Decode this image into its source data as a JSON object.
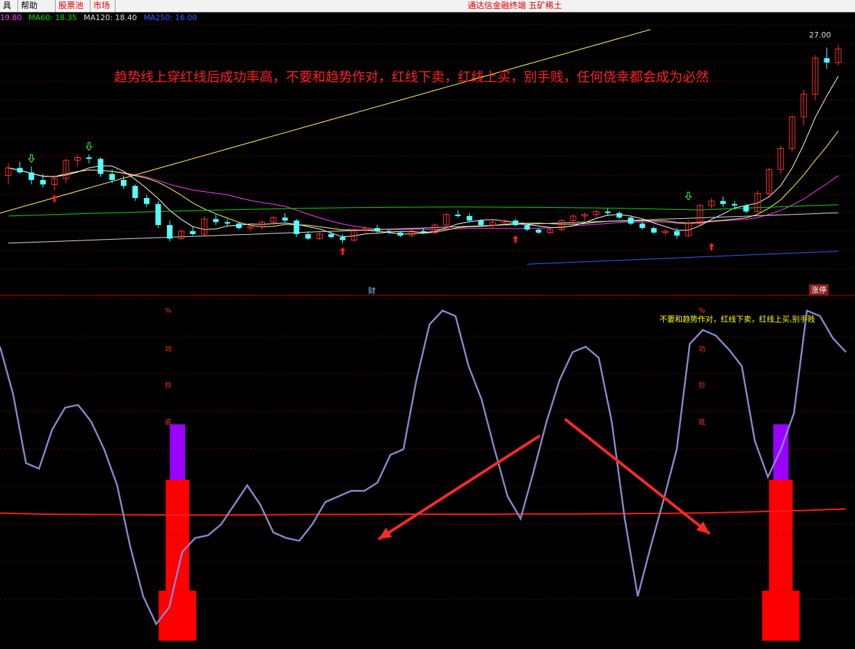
{
  "menu": {
    "items": [
      {
        "label": "具",
        "style": "normal"
      },
      {
        "label": "帮助",
        "style": "normal"
      },
      {
        "label": "股票池",
        "style": "red"
      },
      {
        "label": "市场",
        "style": "red"
      }
    ],
    "app_title": "通达信金融终端 五矿稀土"
  },
  "ma_legend": [
    {
      "label": "19.80",
      "color": "#ff40ff"
    },
    {
      "label": "MA60: 18.35",
      "color": "#00e000"
    },
    {
      "label": "MA120: 18.40",
      "color": "#dddddd"
    },
    {
      "label": "MA250: 16.00",
      "color": "#3a5cff"
    }
  ],
  "main_chart": {
    "headline": "趋势线上穿红线后成功率高，不要和趋势作对，红线下卖，红线上买，别手贱，任何侥幸都会成为必然",
    "price_label": "27.00",
    "marker_cai": "财",
    "marker_zhangting": "涨停"
  },
  "sub_chart": {
    "note": "不要和趋势作对，红线下卖，红线上买,别手贱",
    "bar_label_chars": [
      "%",
      "功",
      "抄",
      "底"
    ]
  },
  "colors": {
    "up": "#ff3030",
    "down": "#54ffff",
    "ma5": "#ffffff",
    "ma10": "#ffff66",
    "ma20": "#ff40ff",
    "ma60": "#00e000",
    "ma120": "#dddddd",
    "ma250": "#3a5cff",
    "trendline": "#ffff66",
    "oscillator": "#8888cc",
    "signal_line": "#ff1a1a",
    "bar_red": "#ff0000",
    "bar_purple": "#9a00ff",
    "grid": "#800000"
  },
  "chart_data": [
    {
      "type": "candlestick",
      "title": "",
      "ylim": [
        11.5,
        28.5
      ],
      "candles": [
        [
          18.5,
          19.3,
          17.9,
          19.0
        ],
        [
          19.0,
          19.4,
          18.6,
          18.7
        ],
        [
          18.7,
          19.1,
          17.9,
          18.2
        ],
        [
          18.2,
          18.6,
          17.7,
          17.9
        ],
        [
          17.9,
          18.5,
          17.5,
          18.3
        ],
        [
          18.3,
          19.6,
          18.0,
          19.5
        ],
        [
          19.5,
          19.9,
          19.1,
          19.7
        ],
        [
          19.7,
          19.9,
          19.3,
          19.6
        ],
        [
          19.6,
          19.7,
          18.4,
          18.6
        ],
        [
          18.6,
          18.9,
          18.0,
          18.2
        ],
        [
          18.2,
          18.5,
          17.6,
          17.8
        ],
        [
          17.8,
          17.9,
          16.8,
          17.0
        ],
        [
          17.0,
          17.2,
          16.4,
          16.6
        ],
        [
          16.6,
          16.8,
          15.0,
          15.2
        ],
        [
          15.2,
          15.5,
          14.1,
          14.3
        ],
        [
          14.3,
          14.9,
          14.2,
          14.8
        ],
        [
          14.8,
          15.1,
          14.5,
          14.6
        ],
        [
          14.6,
          15.8,
          14.5,
          15.6
        ],
        [
          15.6,
          15.9,
          15.2,
          15.4
        ],
        [
          15.4,
          15.6,
          15.1,
          15.3
        ],
        [
          15.3,
          15.4,
          14.9,
          15.0
        ],
        [
          15.0,
          15.3,
          14.8,
          15.1
        ],
        [
          15.1,
          15.5,
          14.9,
          15.4
        ],
        [
          15.4,
          15.8,
          15.2,
          15.7
        ],
        [
          15.7,
          16.0,
          15.4,
          15.5
        ],
        [
          15.5,
          15.6,
          14.4,
          14.6
        ],
        [
          14.6,
          14.8,
          14.2,
          14.3
        ],
        [
          14.3,
          14.7,
          14.2,
          14.6
        ],
        [
          14.6,
          14.8,
          14.3,
          14.4
        ],
        [
          14.4,
          14.6,
          14.0,
          14.2
        ],
        [
          14.2,
          15.0,
          14.1,
          14.9
        ],
        [
          14.9,
          15.1,
          14.7,
          15.0
        ],
        [
          15.0,
          15.2,
          14.7,
          14.8
        ],
        [
          14.8,
          14.9,
          14.6,
          14.7
        ],
        [
          14.7,
          14.8,
          14.4,
          14.5
        ],
        [
          14.5,
          14.9,
          14.4,
          14.8
        ],
        [
          14.8,
          15.0,
          14.6,
          14.7
        ],
        [
          14.7,
          15.3,
          14.6,
          15.2
        ],
        [
          15.2,
          16.0,
          15.0,
          15.9
        ],
        [
          15.9,
          16.2,
          15.7,
          15.8
        ],
        [
          15.8,
          16.0,
          15.4,
          15.5
        ],
        [
          15.5,
          15.6,
          15.1,
          15.2
        ],
        [
          15.2,
          15.5,
          15.0,
          15.4
        ],
        [
          15.4,
          15.6,
          15.2,
          15.5
        ],
        [
          15.5,
          15.6,
          15.1,
          15.2
        ],
        [
          15.2,
          15.3,
          14.8,
          14.9
        ],
        [
          14.9,
          15.0,
          14.6,
          14.7
        ],
        [
          14.7,
          15.0,
          14.6,
          14.9
        ],
        [
          14.9,
          15.6,
          14.8,
          15.5
        ],
        [
          15.5,
          15.9,
          15.3,
          15.8
        ],
        [
          15.8,
          16.0,
          15.5,
          15.9
        ],
        [
          15.9,
          16.2,
          15.7,
          16.1
        ],
        [
          16.1,
          16.3,
          15.8,
          16.0
        ],
        [
          16.0,
          16.1,
          15.6,
          15.7
        ],
        [
          15.7,
          15.8,
          15.2,
          15.3
        ],
        [
          15.3,
          15.4,
          14.9,
          15.0
        ],
        [
          15.0,
          15.1,
          14.6,
          14.7
        ],
        [
          14.7,
          14.9,
          14.5,
          14.8
        ],
        [
          14.8,
          15.0,
          14.3,
          14.5
        ],
        [
          14.5,
          15.5,
          14.4,
          15.3
        ],
        [
          15.3,
          16.6,
          15.2,
          16.5
        ],
        [
          16.5,
          17.0,
          16.3,
          16.8
        ],
        [
          16.8,
          17.1,
          16.4,
          16.6
        ],
        [
          16.6,
          16.8,
          16.2,
          16.5
        ],
        [
          16.5,
          16.6,
          16.0,
          16.1
        ],
        [
          16.1,
          17.5,
          16.0,
          17.3
        ],
        [
          17.3,
          19.0,
          17.1,
          18.9
        ],
        [
          18.9,
          20.5,
          18.6,
          20.3
        ],
        [
          20.3,
          22.5,
          20.1,
          22.4
        ],
        [
          22.4,
          24.2,
          21.8,
          23.9
        ],
        [
          23.9,
          26.5,
          23.5,
          26.3
        ],
        [
          26.3,
          27.0,
          25.6,
          26.0
        ],
        [
          26.0,
          27.2,
          25.8,
          26.9
        ]
      ],
      "moving_averages": [
        "MA60",
        "MA120",
        "MA250"
      ],
      "annotations": [
        "财",
        "涨停",
        "27.00"
      ]
    },
    {
      "type": "line",
      "title": "",
      "ylim": [
        0,
        100
      ],
      "series": [
        {
          "name": "",
          "values": [
            82,
            65,
            40,
            38,
            52,
            60,
            61,
            55,
            45,
            32,
            10,
            -8,
            -18,
            -12,
            8,
            13,
            14,
            18,
            25,
            32,
            25,
            15,
            13,
            12,
            18,
            26,
            28,
            30,
            30,
            33,
            43,
            45,
            70,
            90,
            95,
            93,
            75,
            63,
            45,
            28,
            20,
            37,
            55,
            70,
            80,
            82,
            78,
            55,
            20,
            -8,
            10,
            27,
            45,
            83,
            88,
            86,
            81,
            75,
            48,
            35,
            45,
            58,
            95,
            93,
            85,
            80
          ]
        },
        {
          "name": "",
          "values": [
            22,
            21.6,
            21.5,
            21.4,
            21.3,
            21.3,
            21.4,
            21.5,
            21.5,
            21.6,
            21.6,
            21.6,
            21.7,
            21.7,
            21.8,
            21.9,
            22.1,
            22.5,
            22.9,
            23.5
          ]
        }
      ],
      "bars": [
        {
          "x_index": 13,
          "levels": [
            {
              "value": -24,
              "top": -6,
              "color": "red"
            },
            {
              "value": -6,
              "top": 14,
              "color": "red"
            },
            {
              "value": 14,
              "top": 34,
              "color": "red"
            },
            {
              "value": 34,
              "top": 54,
              "color": "purple"
            }
          ]
        },
        {
          "x_index": 60,
          "levels": [
            {
              "value": -24,
              "top": -6,
              "color": "red"
            },
            {
              "value": -6,
              "top": 14,
              "color": "red"
            },
            {
              "value": 14,
              "top": 34,
              "color": "red"
            },
            {
              "value": 34,
              "top": 54,
              "color": "purple"
            }
          ]
        }
      ],
      "arrows": [
        "red arrow to signal line near x_index 33",
        "red arrow to signal line near x_index 62"
      ]
    }
  ]
}
